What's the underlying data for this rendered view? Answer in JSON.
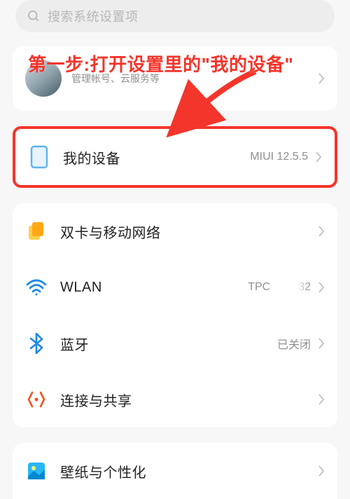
{
  "search": {
    "placeholder": "搜索系统设置项"
  },
  "annotation": {
    "text": "第一步:打开设置里的\"我的设备\""
  },
  "account": {
    "subtitle": "管理帐号、云服务等"
  },
  "device": {
    "title": "我的设备",
    "value": "MIUI 12.5.5"
  },
  "network": {
    "sim": {
      "title": "双卡与移动网络"
    },
    "wlan": {
      "title": "WLAN",
      "value_start": "TPC",
      "value_end": "32"
    },
    "bluetooth": {
      "title": "蓝牙",
      "value": "已关闭"
    },
    "share": {
      "title": "连接与共享"
    }
  },
  "personalize": {
    "title": "壁纸与个性化"
  }
}
